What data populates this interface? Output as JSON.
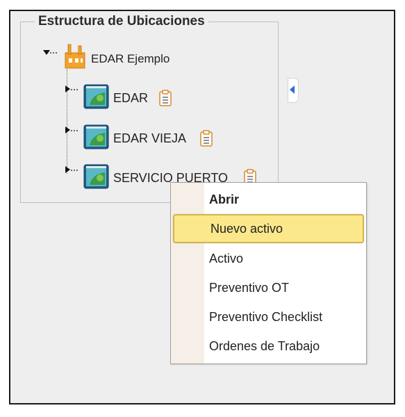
{
  "panel": {
    "title": "Estructura de Ubicaciones"
  },
  "tree": {
    "root": {
      "label": "EDAR Ejemplo",
      "icon": "factory-icon"
    },
    "children": [
      {
        "label": "EDAR",
        "icon": "location-map-icon",
        "badge_icon": "clipboard-icon"
      },
      {
        "label": "EDAR VIEJA",
        "icon": "location-map-icon",
        "badge_icon": "clipboard-icon"
      },
      {
        "label": "SERVICIO PUERTO",
        "icon": "location-map-icon",
        "badge_icon": "clipboard-icon"
      }
    ]
  },
  "context_menu": {
    "items": [
      {
        "label": "Abrir",
        "style": "bold"
      },
      {
        "label": "Nuevo activo",
        "state": "highlighted"
      },
      {
        "label": "Activo"
      },
      {
        "label": "Preventivo OT"
      },
      {
        "label": "Preventivo Checklist"
      },
      {
        "label": "Ordenes de Trabajo"
      }
    ]
  },
  "colors": {
    "highlight_fill": "#fbe88a",
    "highlight_border": "#d3b34a",
    "expander_arrow": "#2a6fd6"
  }
}
